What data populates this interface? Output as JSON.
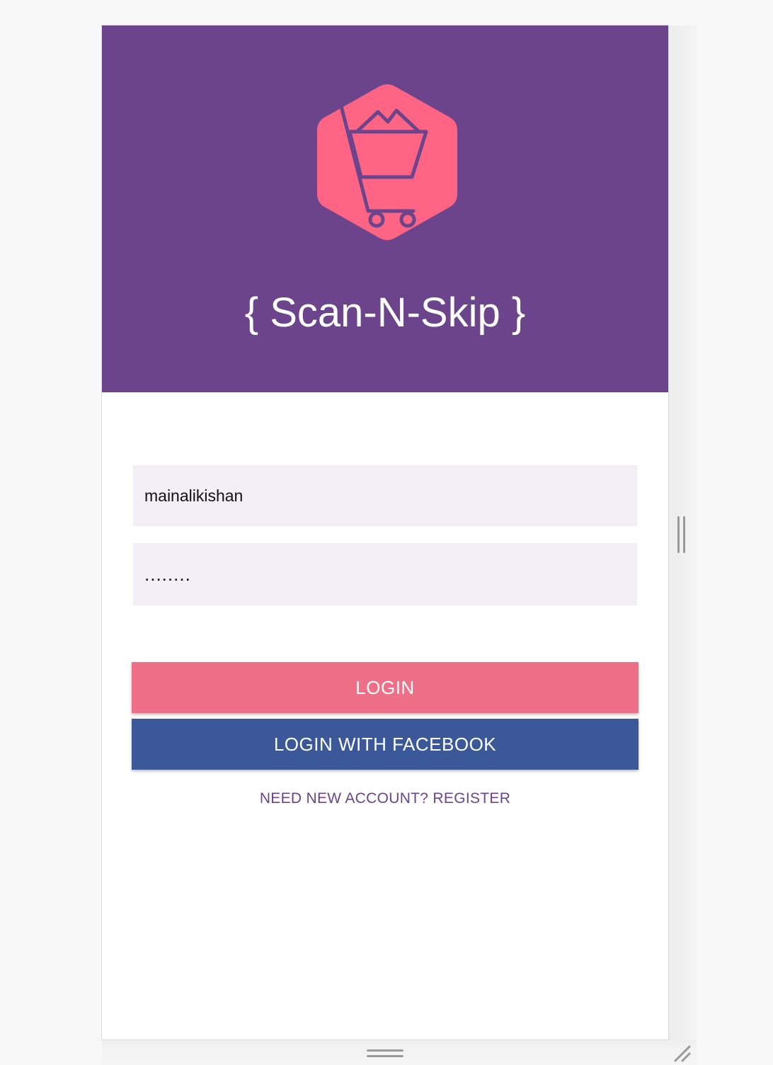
{
  "app": {
    "title": "{ Scan-N-Skip }",
    "logo_icon": "shopping-cart-hexagon-icon"
  },
  "form": {
    "username_value": "mainalikishan",
    "password_value": "........"
  },
  "buttons": {
    "login_label": "LOGIN",
    "facebook_label": "LOGIN WITH FACEBOOK",
    "register_label": "NEED NEW ACCOUNT? REGISTER"
  },
  "colors": {
    "header": "#6b448b",
    "logo_hexagon": "#fe6585",
    "login_button": "#ee6f88",
    "facebook_button": "#3b5998",
    "register_link": "#6b448b",
    "field_background": "#f2f0f6"
  },
  "emulator": {
    "side_resize_icon": "vertical-resize-handle-icon",
    "bottom_resize_icon": "horizontal-resize-handle-icon",
    "corner_resize_icon": "corner-resize-handle-icon"
  }
}
